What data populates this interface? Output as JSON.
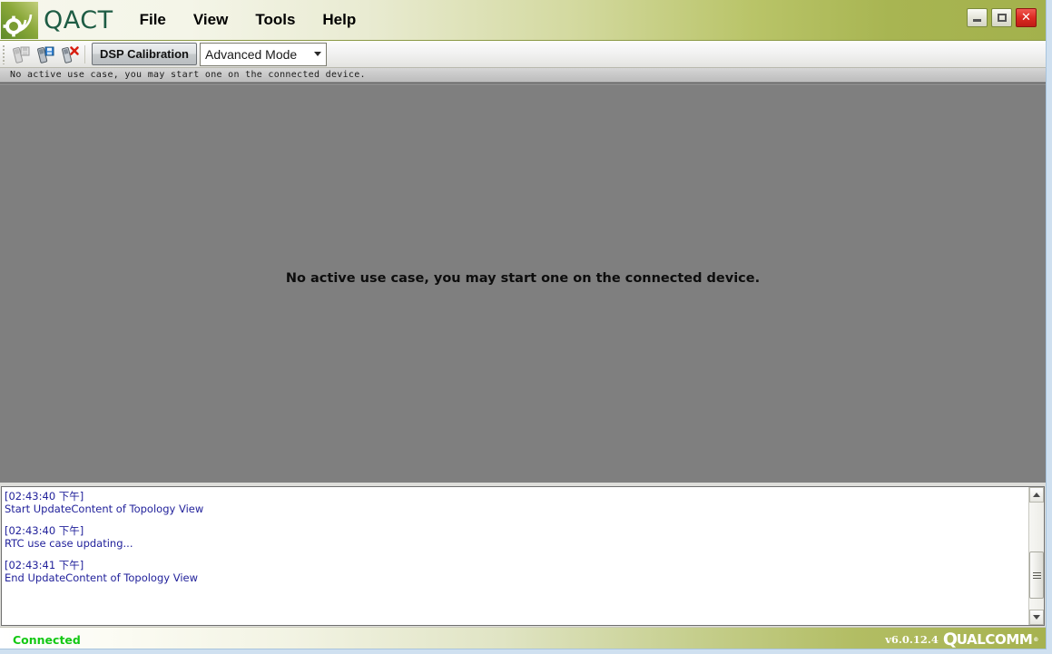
{
  "window": {
    "app_title": "QACT",
    "logo_icon": "qact-signal-gear-logo",
    "controls": {
      "minimize": {
        "name": "minimize-button",
        "icon": "minimize-icon",
        "label": ""
      },
      "maximize": {
        "name": "maximize-button",
        "icon": "maximize-icon",
        "label": ""
      },
      "close": {
        "name": "close-button",
        "icon": "close-icon",
        "label": "✕"
      }
    },
    "close_color": "#dc2a22"
  },
  "menubar": {
    "items": [
      {
        "label": "File"
      },
      {
        "label": "View"
      },
      {
        "label": "Tools"
      },
      {
        "label": "Help"
      }
    ]
  },
  "toolbar": {
    "buttons": [
      {
        "name": "save-to-phone-button",
        "icon": "phone-save-disabled-icon",
        "tooltip": "Save to phone"
      },
      {
        "name": "load-from-phone-button",
        "icon": "phone-save-icon",
        "tooltip": "Load from phone"
      },
      {
        "name": "disconnect-phone-button",
        "icon": "phone-delete-icon",
        "tooltip": "Disconnect phone"
      }
    ],
    "dsp_calibration_label": "DSP Calibration",
    "mode_combo": {
      "selected": "Advanced Mode",
      "options": [
        "Advanced Mode"
      ],
      "arrow_icon": "chevron-down-icon"
    }
  },
  "info_strip": {
    "message": "No active use case, you may start one on the connected device."
  },
  "canvas": {
    "message": "No active use case, you may start one on the connected device.",
    "background_color": "#7f7f7f"
  },
  "log": {
    "entries": [
      {
        "timestamp": "[02:43:40 下午]",
        "message": "Start UpdateContent of Topology View"
      },
      {
        "timestamp": "[02:43:40 下午]",
        "message": "RTC use case updating..."
      },
      {
        "timestamp": "[02:43:41 下午]",
        "message": "End UpdateContent of Topology View"
      }
    ],
    "text_color": "#22229b",
    "scrollbar": {
      "up_icon": "scroll-up-arrow-icon",
      "down_icon": "scroll-down-arrow-icon",
      "thumb_name": "scrollbar-thumb"
    }
  },
  "statusbar": {
    "connection_status": "Connected",
    "connection_color": "#14c814",
    "version": "v6.0.12.4",
    "brand": "UALCOMM",
    "brand_q": "Q",
    "brand_mark": "®"
  }
}
